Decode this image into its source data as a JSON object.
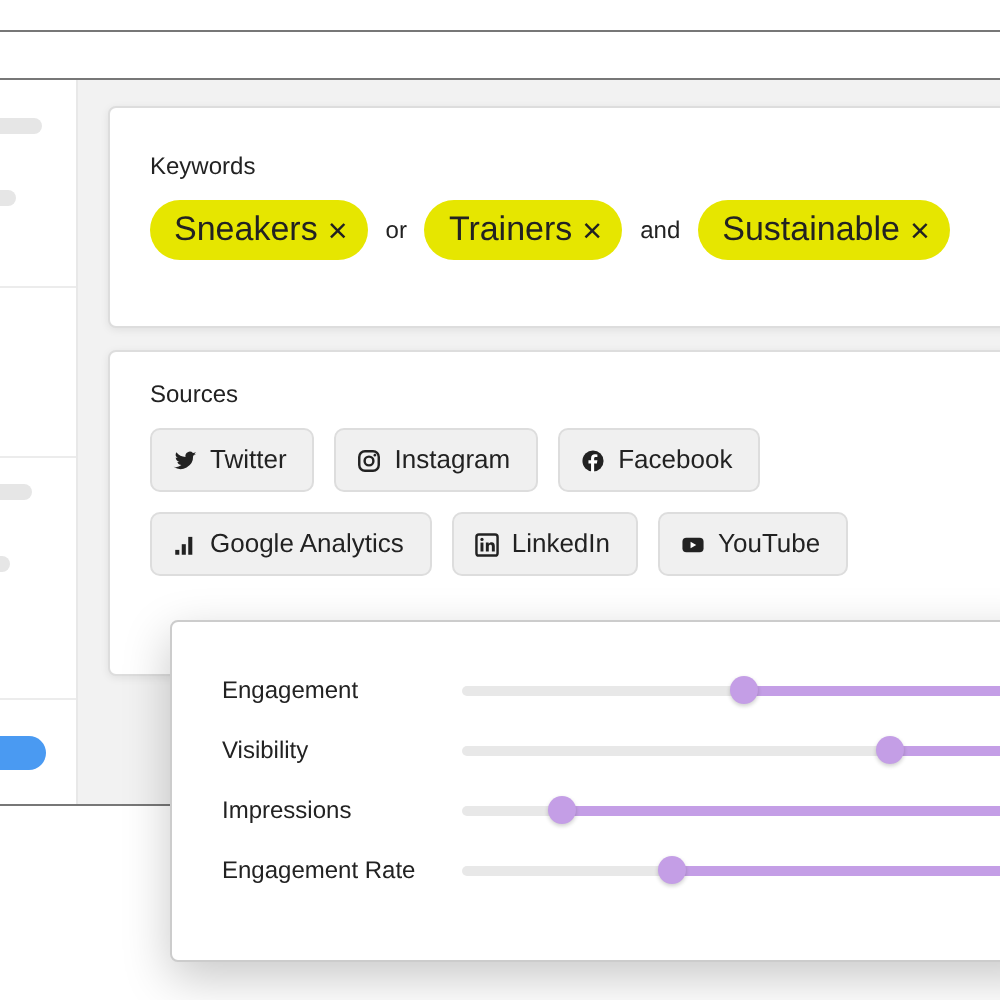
{
  "keywords": {
    "label": "Keywords",
    "items": [
      {
        "kind": "chip",
        "text": "Sneakers",
        "remove": "×"
      },
      {
        "kind": "operator",
        "text": "or"
      },
      {
        "kind": "chip",
        "text": "Trainers",
        "remove": "×"
      },
      {
        "kind": "operator",
        "text": "and"
      },
      {
        "kind": "chip",
        "text": "Sustainable",
        "remove": "×"
      }
    ]
  },
  "sources": {
    "label": "Sources",
    "buttons": [
      {
        "label": "Twitter"
      },
      {
        "label": "Instagram"
      },
      {
        "label": "Facebook"
      },
      {
        "label": "Google Analytics"
      },
      {
        "label": "LinkedIn"
      },
      {
        "label": "YouTube"
      }
    ]
  },
  "metrics": [
    {
      "label": "Engagement",
      "level": 0.52
    },
    {
      "label": "Visibility",
      "level": 0.27
    },
    {
      "label": "Impressions",
      "level": 0.83
    },
    {
      "label": "Engagement Rate",
      "level": 0.64
    }
  ]
}
